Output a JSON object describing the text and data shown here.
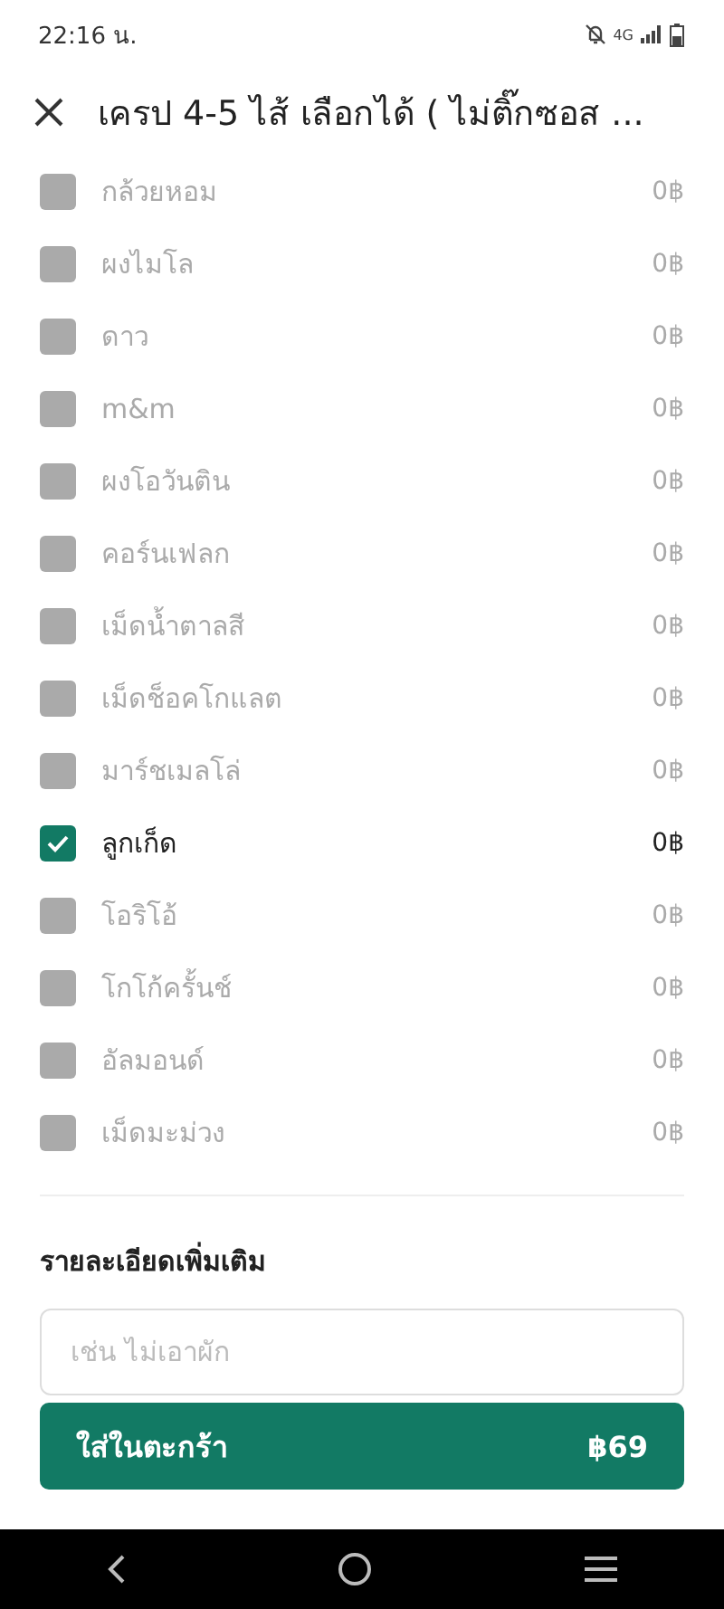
{
  "status_bar": {
    "time": "22:16 น.",
    "network": "4G"
  },
  "header": {
    "title": "เครป 4-5 ไส้ เลือกได้ ( ไม่ติ๊กซอส ..."
  },
  "options": [
    {
      "name": "กล้วยหอม",
      "price": "0฿",
      "checked": false,
      "disabled": true
    },
    {
      "name": "ผงไมโล",
      "price": "0฿",
      "checked": false,
      "disabled": true
    },
    {
      "name": "ดาว",
      "price": "0฿",
      "checked": false,
      "disabled": true
    },
    {
      "name": "m&m",
      "price": "0฿",
      "checked": false,
      "disabled": true
    },
    {
      "name": "ผงโอวันติน",
      "price": "0฿",
      "checked": false,
      "disabled": true
    },
    {
      "name": "คอร์นเฟลก",
      "price": "0฿",
      "checked": false,
      "disabled": true
    },
    {
      "name": "เม็ดน้ำตาลสี",
      "price": "0฿",
      "checked": false,
      "disabled": true
    },
    {
      "name": "เม็ดช็อคโกแลต",
      "price": "0฿",
      "checked": false,
      "disabled": true
    },
    {
      "name": "มาร์ชเมลโล่",
      "price": "0฿",
      "checked": false,
      "disabled": true
    },
    {
      "name": "ลูกเก็ด",
      "price": "0฿",
      "checked": true,
      "disabled": false
    },
    {
      "name": "โอริโอ้",
      "price": "0฿",
      "checked": false,
      "disabled": true
    },
    {
      "name": "โกโก้ครั้นช์",
      "price": "0฿",
      "checked": false,
      "disabled": true
    },
    {
      "name": "อัลมอนด์",
      "price": "0฿",
      "checked": false,
      "disabled": true
    },
    {
      "name": "เม็ดมะม่วง",
      "price": "0฿",
      "checked": false,
      "disabled": true
    }
  ],
  "details": {
    "title": "รายละเอียดเพิ่มเติม",
    "placeholder": "เช่น ไม่เอาผัก"
  },
  "add_button": {
    "label": "ใส่ในตะกร้า",
    "price": "฿69"
  }
}
